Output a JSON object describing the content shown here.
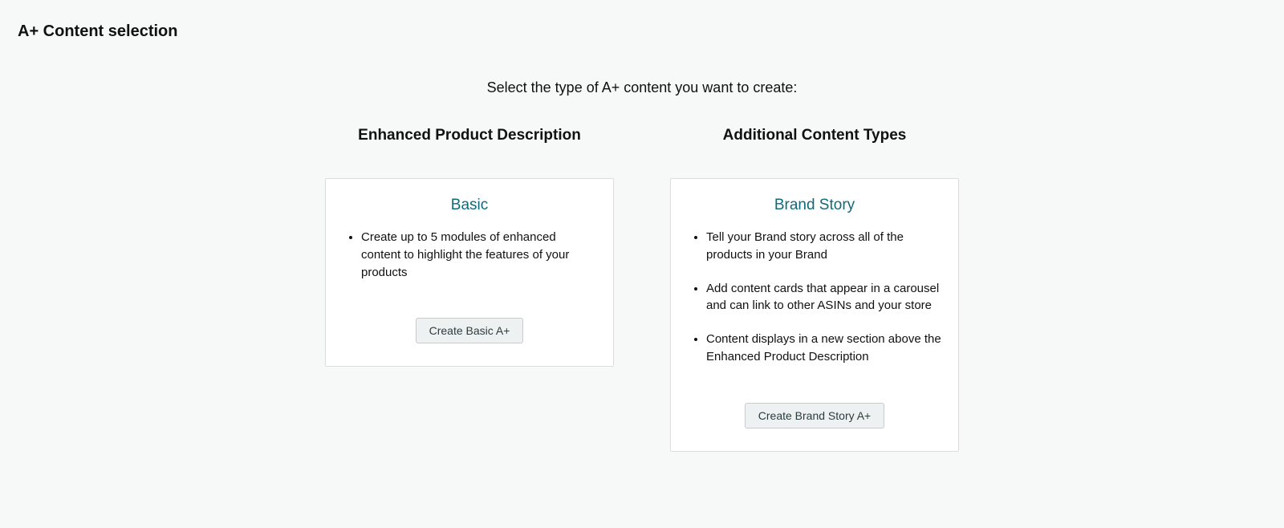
{
  "header": {
    "title": "A+ Content selection"
  },
  "prompt": "Select the type of A+ content you want to create:",
  "columns": {
    "left": {
      "heading": "Enhanced Product Description",
      "card": {
        "title": "Basic",
        "bullets": {
          "b0": "Create up to 5 modules of enhanced content to highlight the features of your products"
        },
        "button": "Create Basic A+"
      }
    },
    "right": {
      "heading": "Additional Content Types",
      "card": {
        "title": "Brand Story",
        "bullets": {
          "b0": "Tell your Brand story across all of the products in your Brand",
          "b1": "Add content cards that appear in a carousel and can link to other ASINs and your store",
          "b2": "Content displays in a new section above the Enhanced Product Description"
        },
        "button": "Create Brand Story A+"
      }
    }
  }
}
